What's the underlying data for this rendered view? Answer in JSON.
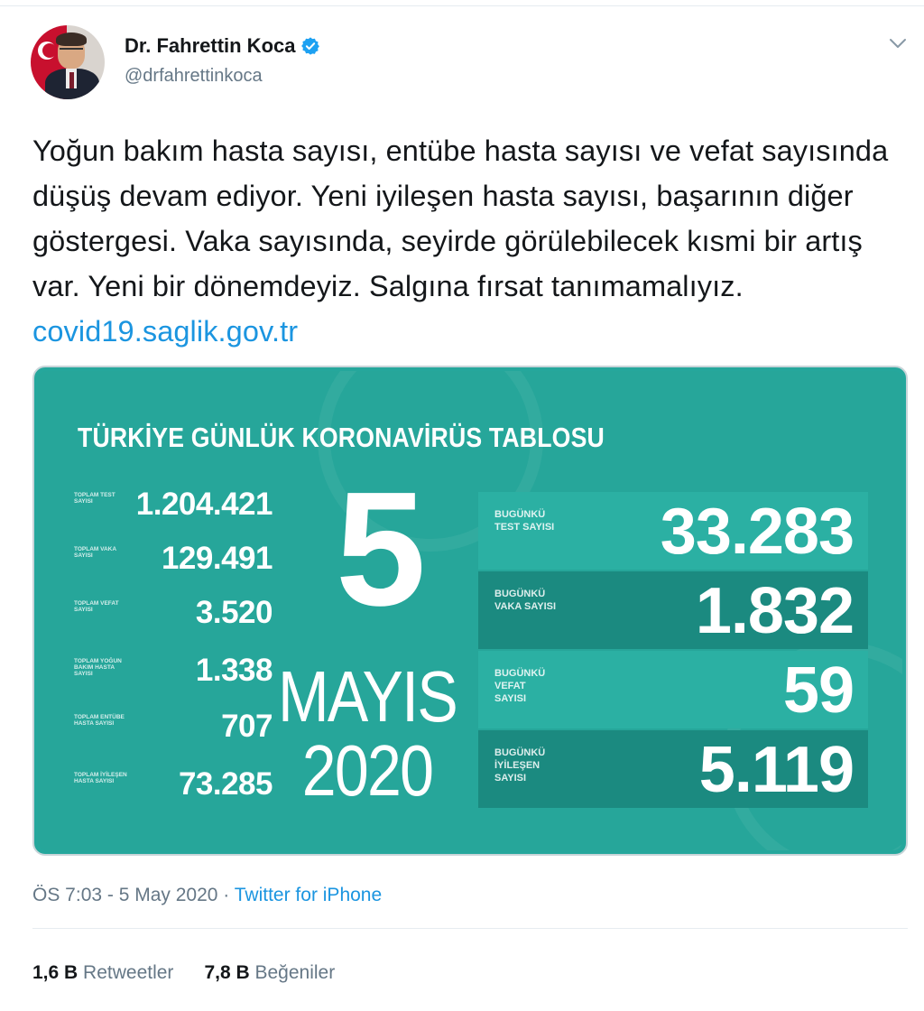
{
  "author": {
    "display_name": "Dr. Fahrettin Koca",
    "handle": "@drfahrettinkoca"
  },
  "tweet": {
    "text": "Yoğun bakım hasta sayısı, entübe hasta sayısı ve vefat sayısında düşüş devam ediyor. Yeni iyileşen hasta sayısı, başarının diğer göstergesi. Vaka sayısında, seyirde görülebilecek kısmi bir artış var. Yeni bir dönemdeyiz. Salgına fırsat tanımamalıyız.",
    "link": "covid19.saglik.gov.tr",
    "time": "ÖS 7:03 - 5 May 2020",
    "separator": " · ",
    "source": "Twitter for iPhone"
  },
  "card": {
    "title": "TÜRKİYE GÜNLÜK KORONAVİRÜS TABLOSU",
    "day": "5",
    "month": "MAYIS",
    "year": "2020",
    "totals": [
      {
        "label": "TOPLAM TEST SAYISI",
        "value": "1.204.421"
      },
      {
        "label": "TOPLAM VAKA SAYISI",
        "value": "129.491"
      },
      {
        "label": "TOPLAM VEFAT SAYISI",
        "value": "3.520"
      },
      {
        "label": "TOPLAM YOĞUN BAKIM HASTA SAYISI",
        "value": "1.338"
      },
      {
        "label": "TOPLAM ENTÜBE HASTA SAYISI",
        "value": "707"
      },
      {
        "label": "TOPLAM İYİLEŞEN HASTA SAYISI",
        "value": "73.285"
      }
    ],
    "today": [
      {
        "label": "BUGÜNKÜ TEST SAYISI",
        "value": "33.283"
      },
      {
        "label": "BUGÜNKÜ VAKA SAYISI",
        "value": "1.832"
      },
      {
        "label": "BUGÜNKÜ VEFAT SAYISI",
        "value": "59"
      },
      {
        "label": "BUGÜNKÜ İYİLEŞEN SAYISI",
        "value": "5.119"
      }
    ]
  },
  "engagement": {
    "retweets_count": "1,6 B",
    "retweets_label": "Retweetler",
    "likes_count": "7,8 B",
    "likes_label": "Beğeniler"
  },
  "icons": {
    "verified": "verified-badge-icon",
    "menu": "chevron-down-icon"
  },
  "colors": {
    "card_teal": "#26a69a",
    "link_blue": "#1b95e0",
    "verified_blue": "#1da1f2"
  }
}
